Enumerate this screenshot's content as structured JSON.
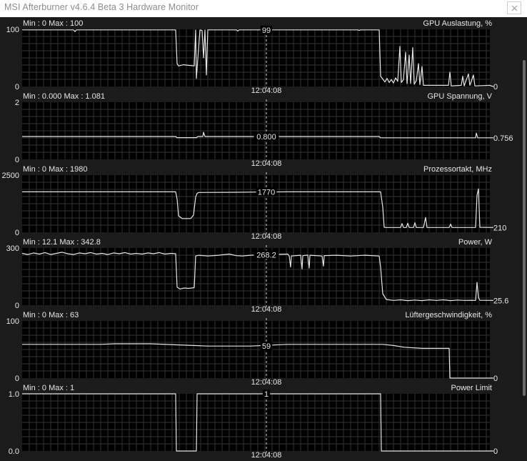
{
  "window": {
    "title": "MSI Afterburner v4.6.4 Beta 3 Hardware Monitor",
    "close_icon": "close-icon"
  },
  "cursor_time": "12:04:08",
  "colors": {
    "background": "#1b1b1b",
    "plot_background": "#000000",
    "grid": "#333333",
    "line": "#e6e6e6",
    "text": "#e6e6e6"
  },
  "graphs": [
    {
      "id": "gpu-usage",
      "label": "GPU Auslastung, %",
      "min_max": "Min : 0   Max : 100",
      "y_max_label": "100",
      "y_min_label": "0",
      "y_range": [
        0,
        100
      ],
      "cursor_value": "99",
      "current_value": "0",
      "series": [
        [
          0,
          99
        ],
        [
          72,
          99
        ],
        [
          74,
          96
        ],
        [
          76,
          99
        ],
        [
          215,
          99
        ],
        [
          217,
          40
        ],
        [
          219,
          36
        ],
        [
          226,
          38
        ],
        [
          233,
          37
        ],
        [
          241,
          36
        ],
        [
          243,
          99
        ],
        [
          244,
          14
        ],
        [
          249,
          99
        ],
        [
          252,
          98
        ],
        [
          254,
          50
        ],
        [
          256,
          99
        ],
        [
          258,
          20
        ],
        [
          260,
          99
        ],
        [
          300,
          99
        ],
        [
          302,
          97
        ],
        [
          304,
          99
        ],
        [
          430,
          99
        ],
        [
          470,
          99
        ],
        [
          472,
          98
        ],
        [
          474,
          99
        ],
        [
          500,
          99
        ],
        [
          502,
          18
        ],
        [
          505,
          13
        ],
        [
          508,
          8
        ],
        [
          511,
          14
        ],
        [
          514,
          7
        ],
        [
          517,
          12
        ],
        [
          520,
          6
        ],
        [
          523,
          15
        ],
        [
          526,
          9
        ],
        [
          529,
          70
        ],
        [
          531,
          7
        ],
        [
          534,
          12
        ],
        [
          537,
          60
        ],
        [
          539,
          5
        ],
        [
          542,
          55
        ],
        [
          544,
          5
        ],
        [
          547,
          68
        ],
        [
          549,
          4
        ],
        [
          552,
          10
        ],
        [
          555,
          40
        ],
        [
          557,
          3
        ],
        [
          560,
          35
        ],
        [
          562,
          2
        ],
        [
          597,
          2
        ],
        [
          599,
          25
        ],
        [
          601,
          1
        ],
        [
          615,
          2
        ],
        [
          617,
          18
        ],
        [
          619,
          1
        ],
        [
          625,
          22
        ],
        [
          627,
          2
        ],
        [
          632,
          20
        ],
        [
          634,
          1
        ],
        [
          655,
          2
        ],
        [
          657,
          1
        ],
        [
          660,
          0
        ]
      ]
    },
    {
      "id": "gpu-voltage",
      "label": "GPU Spannung, V",
      "min_max": "Min : 0.000   Max : 1.081",
      "y_max_label": "2",
      "y_min_label": "0",
      "y_range": [
        0,
        2
      ],
      "cursor_value": "0.800",
      "current_value": "0.756",
      "series": [
        [
          0,
          0.8
        ],
        [
          215,
          0.8
        ],
        [
          217,
          0.76
        ],
        [
          244,
          0.76
        ],
        [
          246,
          0.8
        ],
        [
          253,
          0.8
        ],
        [
          254,
          0.95
        ],
        [
          256,
          0.8
        ],
        [
          500,
          0.8
        ],
        [
          502,
          0.756
        ],
        [
          635,
          0.756
        ],
        [
          636,
          0.92
        ],
        [
          638,
          0.756
        ],
        [
          660,
          0.756
        ]
      ]
    },
    {
      "id": "core-clock",
      "label": "Prozessortakt, MHz",
      "min_max": "Min : 0   Max : 1980",
      "y_max_label": "2500",
      "y_min_label": "0",
      "y_range": [
        0,
        2500
      ],
      "cursor_value": "1770",
      "current_value": "210",
      "series": [
        [
          0,
          1770
        ],
        [
          215,
          1770
        ],
        [
          217,
          1450
        ],
        [
          219,
          720
        ],
        [
          224,
          600
        ],
        [
          236,
          600
        ],
        [
          240,
          750
        ],
        [
          243,
          1550
        ],
        [
          245,
          1700
        ],
        [
          247,
          1740
        ],
        [
          300,
          1750
        ],
        [
          330,
          1760
        ],
        [
          372,
          1770
        ],
        [
          502,
          1770
        ],
        [
          505,
          1100
        ],
        [
          507,
          220
        ],
        [
          510,
          210
        ],
        [
          530,
          210
        ],
        [
          532,
          380
        ],
        [
          534,
          210
        ],
        [
          538,
          210
        ],
        [
          540,
          400
        ],
        [
          542,
          210
        ],
        [
          548,
          210
        ],
        [
          550,
          420
        ],
        [
          552,
          210
        ],
        [
          562,
          210
        ],
        [
          565,
          650
        ],
        [
          567,
          210
        ],
        [
          598,
          210
        ],
        [
          600,
          360
        ],
        [
          602,
          210
        ],
        [
          635,
          210
        ],
        [
          637,
          1620
        ],
        [
          639,
          1900
        ],
        [
          641,
          220
        ],
        [
          660,
          210
        ]
      ]
    },
    {
      "id": "power",
      "label": "Power, W",
      "min_max": "Min : 12.1   Max : 342.8",
      "y_max_label": "300",
      "y_min_label": "0",
      "y_range": [
        0,
        300
      ],
      "cursor_value": "268.2",
      "current_value": "25.6",
      "series": [
        [
          0,
          272
        ],
        [
          8,
          266
        ],
        [
          16,
          274
        ],
        [
          24,
          268
        ],
        [
          32,
          276
        ],
        [
          40,
          266
        ],
        [
          48,
          272
        ],
        [
          56,
          278
        ],
        [
          64,
          270
        ],
        [
          72,
          266
        ],
        [
          80,
          274
        ],
        [
          88,
          270
        ],
        [
          96,
          276
        ],
        [
          104,
          268
        ],
        [
          112,
          272
        ],
        [
          120,
          266
        ],
        [
          128,
          274
        ],
        [
          136,
          270
        ],
        [
          144,
          276
        ],
        [
          152,
          268
        ],
        [
          160,
          272
        ],
        [
          168,
          268
        ],
        [
          176,
          274
        ],
        [
          184,
          270
        ],
        [
          192,
          276
        ],
        [
          200,
          268
        ],
        [
          208,
          272
        ],
        [
          215,
          270
        ],
        [
          217,
          95
        ],
        [
          221,
          85
        ],
        [
          227,
          90
        ],
        [
          233,
          88
        ],
        [
          241,
          92
        ],
        [
          243,
          258
        ],
        [
          247,
          262
        ],
        [
          260,
          258
        ],
        [
          275,
          262
        ],
        [
          290,
          268
        ],
        [
          300,
          260
        ],
        [
          308,
          258
        ],
        [
          320,
          262
        ],
        [
          335,
          265
        ],
        [
          372,
          268
        ],
        [
          374,
          258
        ],
        [
          376,
          200
        ],
        [
          377,
          258
        ],
        [
          390,
          262
        ],
        [
          392,
          190
        ],
        [
          393,
          260
        ],
        [
          400,
          263
        ],
        [
          402,
          195
        ],
        [
          403,
          262
        ],
        [
          420,
          258
        ],
        [
          422,
          205
        ],
        [
          423,
          260
        ],
        [
          440,
          262
        ],
        [
          460,
          258
        ],
        [
          480,
          262
        ],
        [
          500,
          258
        ],
        [
          502,
          200
        ],
        [
          505,
          60
        ],
        [
          510,
          30
        ],
        [
          520,
          25
        ],
        [
          530,
          28
        ],
        [
          540,
          24
        ],
        [
          550,
          27
        ],
        [
          560,
          24
        ],
        [
          570,
          28
        ],
        [
          580,
          25
        ],
        [
          590,
          28
        ],
        [
          600,
          24
        ],
        [
          610,
          27
        ],
        [
          620,
          25
        ],
        [
          630,
          26
        ],
        [
          635,
          25
        ],
        [
          637,
          120
        ],
        [
          639,
          40
        ],
        [
          641,
          26
        ],
        [
          660,
          25
        ]
      ]
    },
    {
      "id": "fan-speed",
      "label": "Lüftergeschwindigkeit, %",
      "min_max": "Min : 0   Max : 63",
      "y_max_label": "100",
      "y_min_label": "0",
      "y_range": [
        0,
        100
      ],
      "cursor_value": "59",
      "current_value": "0",
      "series": [
        [
          0,
          59
        ],
        [
          110,
          59
        ],
        [
          130,
          60
        ],
        [
          180,
          60
        ],
        [
          220,
          58
        ],
        [
          240,
          57
        ],
        [
          260,
          56
        ],
        [
          320,
          56
        ],
        [
          372,
          59
        ],
        [
          420,
          59
        ],
        [
          480,
          59
        ],
        [
          505,
          59
        ],
        [
          520,
          57
        ],
        [
          535,
          54
        ],
        [
          560,
          52
        ],
        [
          598,
          52
        ],
        [
          599,
          0
        ],
        [
          660,
          0
        ]
      ]
    },
    {
      "id": "power-limit",
      "label": "Power Limit",
      "min_max": "Min : 0   Max : 1",
      "y_max_label": "1.0",
      "y_min_label": "0.0",
      "y_range": [
        0,
        1
      ],
      "cursor_value": "1",
      "current_value": "0",
      "series": [
        [
          0,
          1
        ],
        [
          215,
          1
        ],
        [
          216,
          0
        ],
        [
          244,
          0
        ],
        [
          245,
          1
        ],
        [
          502,
          1
        ],
        [
          503,
          0
        ],
        [
          660,
          0
        ]
      ]
    }
  ]
}
